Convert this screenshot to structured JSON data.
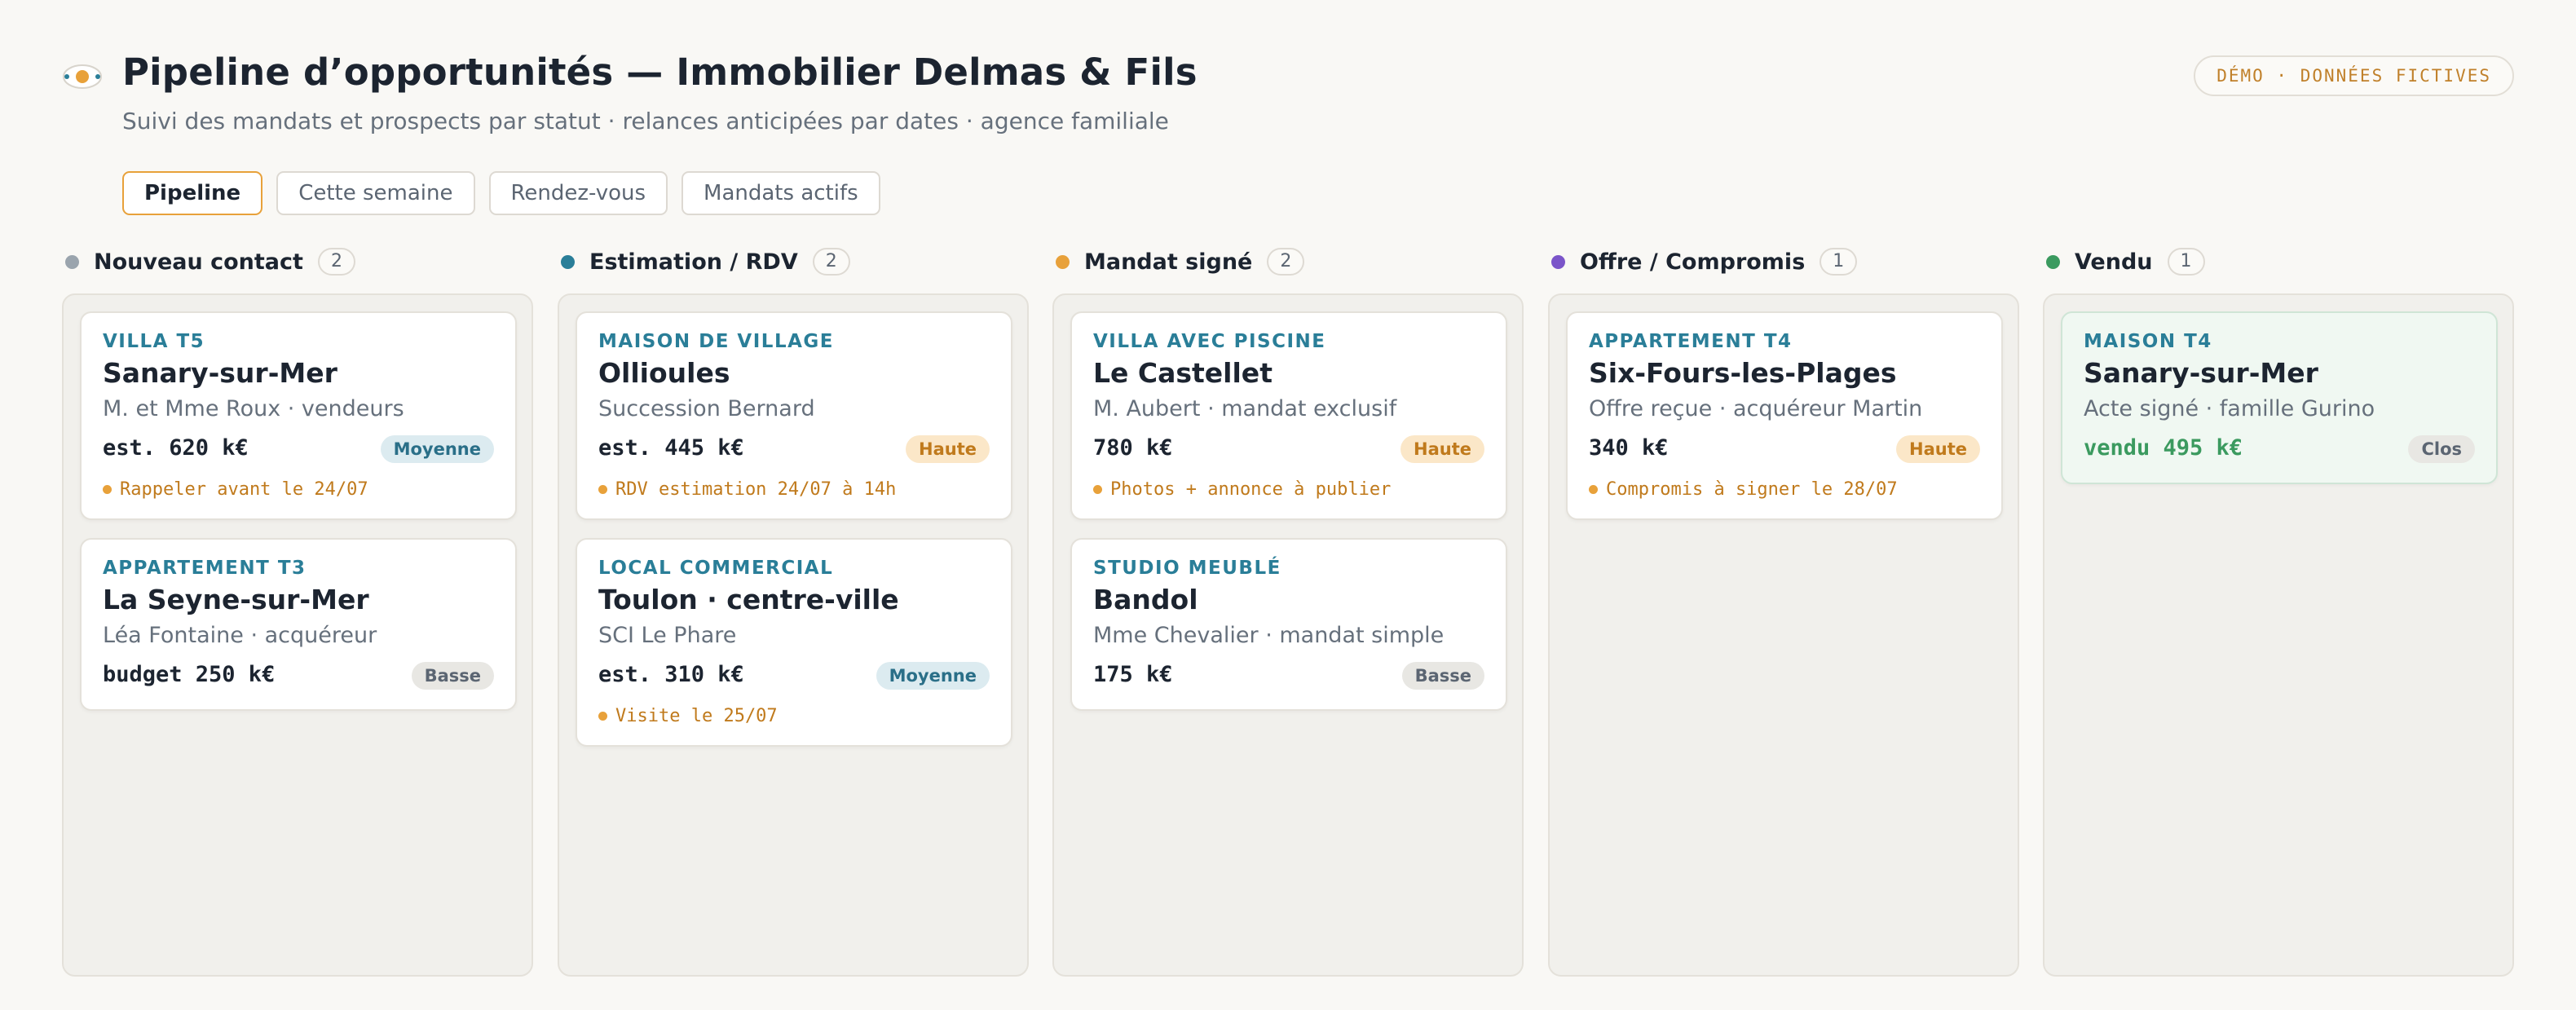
{
  "header": {
    "logo_icon": "eye-logo-icon",
    "title": "Pipeline d’opportunités — Immobilier Delmas & Fils",
    "subtitle": "Suivi des mandats et prospects par statut · relances anticipées par dates · agence familiale",
    "badge": "DÉMO · DONNÉES FICTIVES"
  },
  "tabs": [
    {
      "label": "Pipeline",
      "active": true
    },
    {
      "label": "Cette semaine",
      "active": false
    },
    {
      "label": "Rendez-vous",
      "active": false
    },
    {
      "label": "Mandats actifs",
      "active": false
    }
  ],
  "columns": [
    {
      "title": "Nouveau contact",
      "count": "2",
      "color": "#9aa4ad",
      "cards": [
        {
          "type": "VILLA T5",
          "name": "Sanary-sur-Mer",
          "sub": "M. et Mme Roux · vendeurs",
          "price": "est. 620 k€",
          "priority": "Moyenne",
          "reminder": "Rappeler avant le 24/07"
        },
        {
          "type": "APPARTEMENT T3",
          "name": "La Seyne-sur-Mer",
          "sub": "Léa Fontaine · acquéreur",
          "price": "budget 250 k€",
          "priority": "Basse",
          "reminder": ""
        }
      ]
    },
    {
      "title": "Estimation / RDV",
      "count": "2",
      "color": "#2a7e98",
      "cards": [
        {
          "type": "MAISON DE VILLAGE",
          "name": "Ollioules",
          "sub": "Succession Bernard",
          "price": "est. 445 k€",
          "priority": "Haute",
          "reminder": "RDV estimation 24/07 à 14h"
        },
        {
          "type": "LOCAL COMMERCIAL",
          "name": "Toulon · centre-ville",
          "sub": "SCI Le Phare",
          "price": "est. 310 k€",
          "priority": "Moyenne",
          "reminder": "Visite le 25/07"
        }
      ]
    },
    {
      "title": "Mandat signé",
      "count": "2",
      "color": "#e8a13a",
      "cards": [
        {
          "type": "VILLA AVEC PISCINE",
          "name": "Le Castellet",
          "sub": "M. Aubert · mandat exclusif",
          "price": "780 k€",
          "priority": "Haute",
          "reminder": "Photos + annonce à publier"
        },
        {
          "type": "STUDIO MEUBLÉ",
          "name": "Bandol",
          "sub": "Mme Chevalier · mandat simple",
          "price": "175 k€",
          "priority": "Basse",
          "reminder": ""
        }
      ]
    },
    {
      "title": "Offre / Compromis",
      "count": "1",
      "color": "#7b55c9",
      "cards": [
        {
          "type": "APPARTEMENT T4",
          "name": "Six-Fours-les-Plages",
          "sub": "Offre reçue · acquéreur Martin",
          "price": "340 k€",
          "priority": "Haute",
          "reminder": "Compromis à signer le 28/07"
        }
      ]
    },
    {
      "title": "Vendu",
      "count": "1",
      "color": "#3b9a5f",
      "cards": [
        {
          "type": "MAISON T4",
          "name": "Sanary-sur-Mer",
          "sub": "Acte signé · famille Gurino",
          "price": "vendu 495 k€",
          "priority": "Clos",
          "reminder": "",
          "done": true
        }
      ]
    }
  ]
}
